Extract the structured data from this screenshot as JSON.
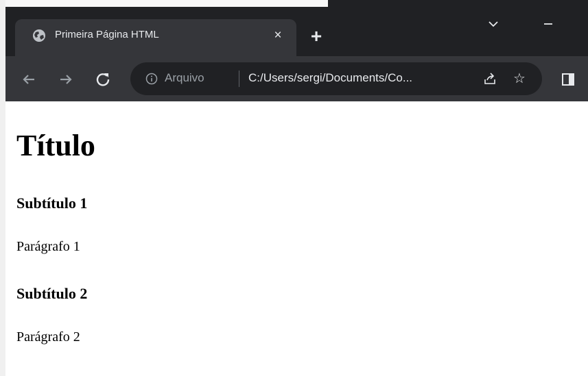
{
  "browser": {
    "tab": {
      "title": "Primeira Página HTML",
      "favicon": "globe-icon",
      "close_label": "×"
    },
    "new_tab_label": "+",
    "address_bar": {
      "scheme_label": "Arquivo",
      "url": "C:/Users/sergi/Documents/Co..."
    },
    "star_glyph": "☆",
    "colors": {
      "frame": "#202124",
      "toolbar": "#35363a",
      "omnibox": "#202124",
      "text": "#e8eaed",
      "muted": "#9aa0a6"
    }
  },
  "page": {
    "heading": "Título",
    "sections": [
      {
        "subtitle": "Subtítulo 1",
        "paragraph": "Parágrafo 1"
      },
      {
        "subtitle": "Subtítulo 2",
        "paragraph": "Parágrafo 2"
      }
    ]
  }
}
